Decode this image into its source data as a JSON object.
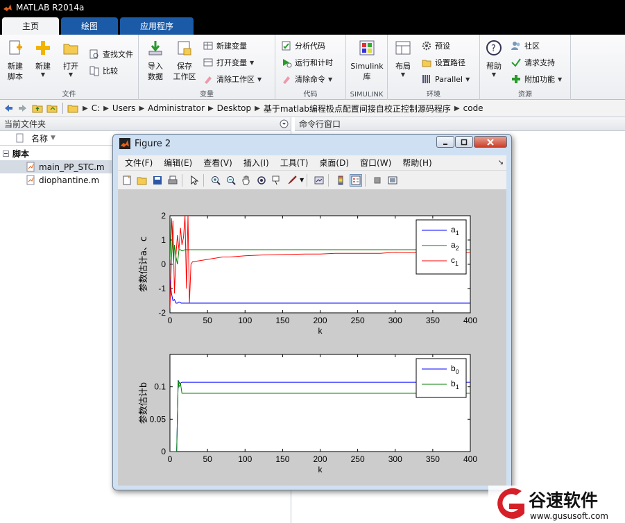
{
  "app": {
    "title": "MATLAB R2014a"
  },
  "tabs": [
    {
      "label": "主页",
      "active": true
    },
    {
      "label": "绘图",
      "active": false
    },
    {
      "label": "应用程序",
      "active": false
    }
  ],
  "ribbon": {
    "file": {
      "label": "文件",
      "new_script": "新建\n脚本",
      "new": "新建",
      "open": "打开",
      "find_files": "查找文件",
      "compare": "比较"
    },
    "variable": {
      "label": "变量",
      "import": "导入\n数据",
      "save_ws": "保存\n工作区",
      "new_var": "新建变量",
      "open_var": "打开变量",
      "clear_ws": "清除工作区"
    },
    "code": {
      "label": "代码",
      "analyze": "分析代码",
      "run_time": "运行和计时",
      "clear_cmds": "清除命令"
    },
    "simulink": {
      "label": "SIMULINK",
      "btn": "Simulink\n库"
    },
    "env": {
      "label": "环境",
      "layout": "布局",
      "prefs": "预设",
      "set_path": "设置路径",
      "parallel": "Parallel"
    },
    "resources": {
      "label": "资源",
      "help": "帮助",
      "community": "社区",
      "support": "请求支持",
      "addons": "附加功能"
    }
  },
  "address": {
    "crumbs": [
      "C:",
      "Users",
      "Administrator",
      "Desktop",
      "基于matlab编程极点配置间接自校正控制源码程序",
      "code"
    ]
  },
  "left_panel": {
    "title": "当前文件夹",
    "col_name": "名称",
    "group": "脚本",
    "files": [
      "main_PP_STC.m",
      "diophantine.m"
    ]
  },
  "right_panel": {
    "title": "命令行窗口"
  },
  "figure": {
    "title": "Figure 2",
    "menu": [
      "文件(F)",
      "编辑(E)",
      "查看(V)",
      "插入(I)",
      "工具(T)",
      "桌面(D)",
      "窗口(W)",
      "帮助(H)"
    ]
  },
  "chart_data": [
    {
      "type": "line",
      "xlabel": "k",
      "ylabel": "参数估计a、c",
      "xlim": [
        0,
        400
      ],
      "ylim": [
        -2,
        2
      ],
      "xticks": [
        0,
        50,
        100,
        150,
        200,
        250,
        300,
        350,
        400
      ],
      "yticks": [
        -2,
        -1,
        0,
        1,
        2
      ],
      "legend_position": "top-right",
      "grid": false,
      "series": [
        {
          "name": "a",
          "sub": "1",
          "color": "#0000ff",
          "x": [
            0,
            2,
            4,
            6,
            8,
            10,
            12,
            15,
            20,
            400
          ],
          "y": [
            -0.6,
            -1.2,
            -1.5,
            -1.45,
            -1.6,
            -1.6,
            -1.55,
            -1.6,
            -1.6,
            -1.6
          ]
        },
        {
          "name": "a",
          "sub": "2",
          "color": "#008000",
          "x": [
            0,
            2,
            3,
            4,
            5,
            6,
            8,
            10,
            12,
            14,
            16,
            20,
            400
          ],
          "y": [
            0.2,
            1.9,
            1.2,
            0.5,
            0.1,
            0.8,
            0.3,
            0.0,
            0.6,
            0.6,
            0.55,
            0.6,
            0.6
          ]
        },
        {
          "name": "c",
          "sub": "1",
          "color": "#ff0000",
          "x": [
            0,
            2,
            4,
            6,
            8,
            10,
            12,
            14,
            16,
            18,
            20,
            22,
            24,
            26,
            28,
            30,
            40,
            50,
            60,
            70,
            80,
            100,
            120,
            150,
            180,
            200,
            220,
            250,
            280,
            300,
            320,
            340,
            360,
            400
          ],
          "y": [
            -1.8,
            0.2,
            1.8,
            -1.2,
            0.4,
            1.2,
            0.6,
            1.5,
            0.8,
            1.1,
            2.0,
            -1.0,
            2.0,
            -1.6,
            0.0,
            0.1,
            0.15,
            0.2,
            0.25,
            0.3,
            0.3,
            0.35,
            0.38,
            0.4,
            0.42,
            0.42,
            0.45,
            0.45,
            0.45,
            0.5,
            0.48,
            0.5,
            0.5,
            0.5
          ]
        }
      ]
    },
    {
      "type": "line",
      "xlabel": "k",
      "ylabel": "参数估计b",
      "xlim": [
        0,
        400
      ],
      "ylim": [
        0,
        0.15
      ],
      "xticks": [
        0,
        50,
        100,
        150,
        200,
        250,
        300,
        350,
        400
      ],
      "yticks": [
        0,
        0.05,
        0.1
      ],
      "legend_position": "top-right",
      "grid": false,
      "series": [
        {
          "name": "b",
          "sub": "0",
          "color": "#0000ff",
          "x": [
            0,
            9,
            11,
            13,
            16,
            400
          ],
          "y": [
            0,
            0,
            0.11,
            0.105,
            0.107,
            0.107
          ]
        },
        {
          "name": "b",
          "sub": "1",
          "color": "#008000",
          "x": [
            0,
            9,
            11,
            12,
            14,
            16,
            18,
            400
          ],
          "y": [
            0,
            0,
            0.11,
            0.1,
            0.105,
            0.09,
            0.09,
            0.09
          ]
        }
      ]
    }
  ],
  "watermark": {
    "brand": "谷速软件",
    "url": "www.gususoft.com"
  }
}
